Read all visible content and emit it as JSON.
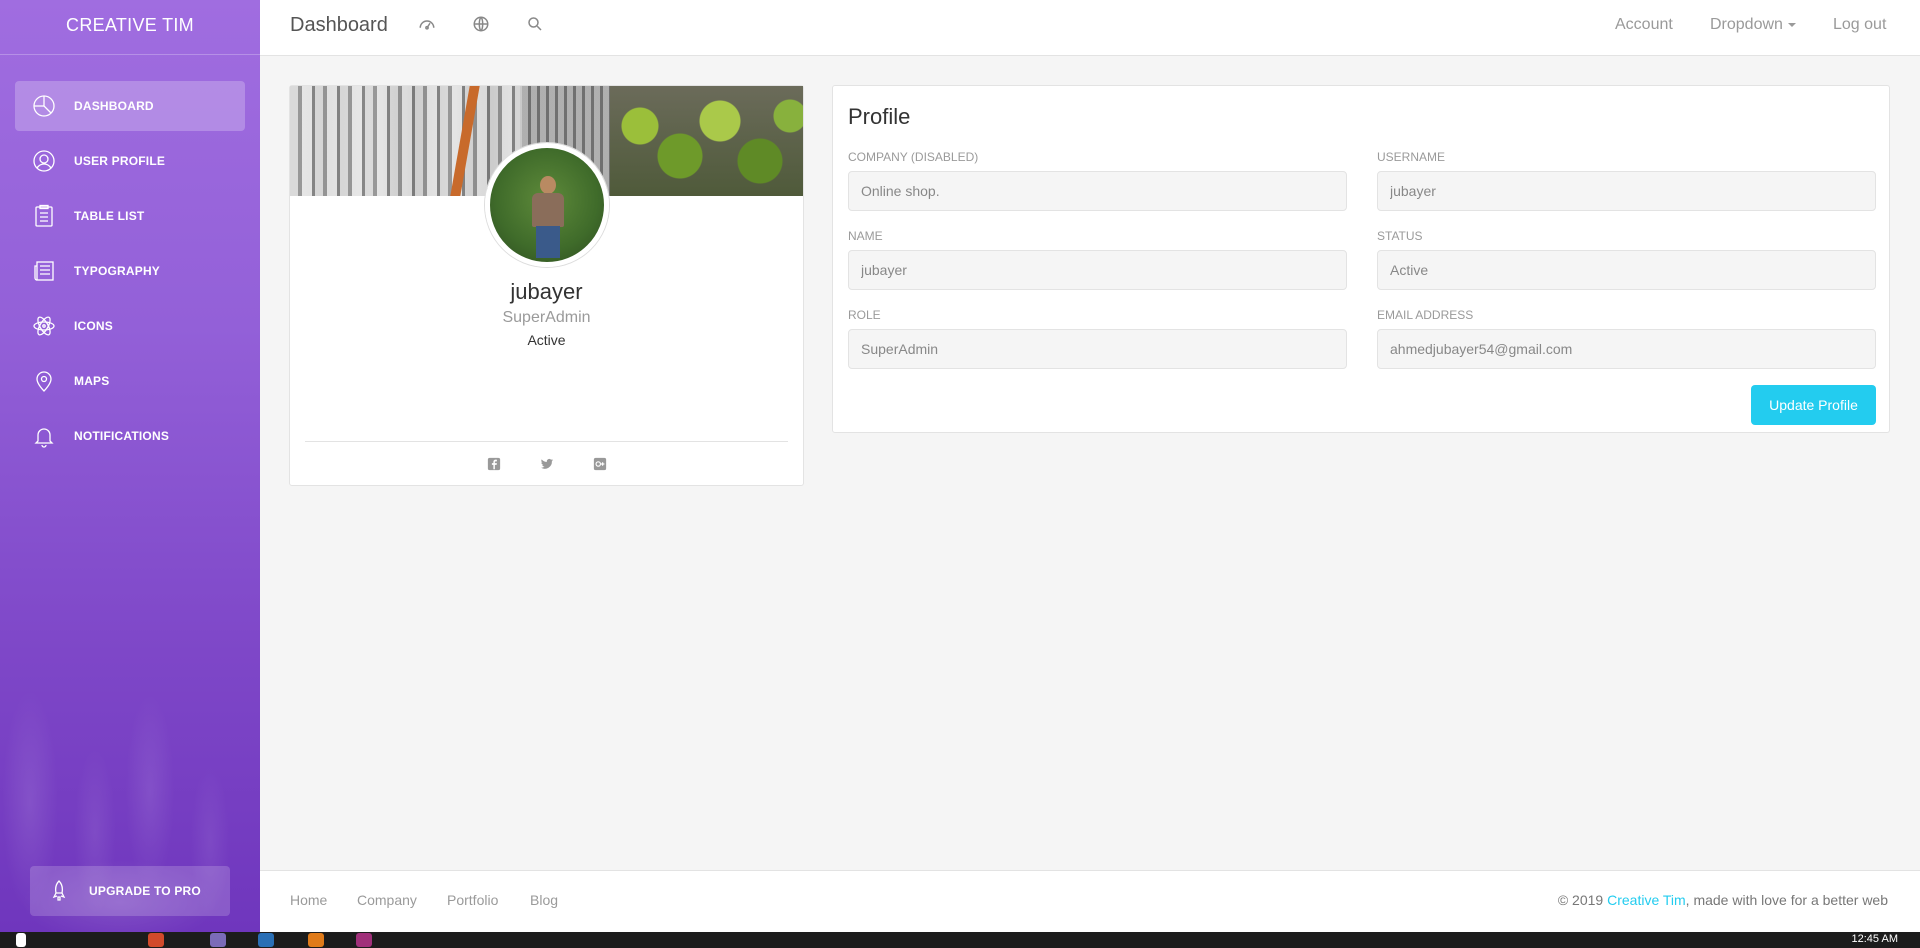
{
  "brand": "CREATIVE TIM",
  "sidebar": {
    "items": [
      {
        "label": "DASHBOARD",
        "icon": "pie-chart-icon",
        "active": true
      },
      {
        "label": "USER PROFILE",
        "icon": "user-icon"
      },
      {
        "label": "TABLE LIST",
        "icon": "clipboard-icon"
      },
      {
        "label": "TYPOGRAPHY",
        "icon": "news-icon"
      },
      {
        "label": "ICONS",
        "icon": "atom-icon"
      },
      {
        "label": "MAPS",
        "icon": "map-pin-icon"
      },
      {
        "label": "NOTIFICATIONS",
        "icon": "bell-icon"
      }
    ],
    "upgrade": {
      "label": "UPGRADE TO PRO",
      "icon": "rocket-icon"
    }
  },
  "topbar": {
    "title": "Dashboard",
    "icons": [
      "dashboard-icon",
      "globe-icon",
      "search-icon"
    ],
    "account": "Account",
    "dropdown": "Dropdown",
    "logout": "Log out"
  },
  "user_card": {
    "name": "jubayer",
    "role": "SuperAdmin",
    "status": "Active",
    "social": [
      "facebook-icon",
      "twitter-icon",
      "google-plus-icon"
    ]
  },
  "profile": {
    "title": "Profile",
    "fields": {
      "company": {
        "label": "COMPANY (DISABLED)",
        "value": "Online shop."
      },
      "username": {
        "label": "USERNAME",
        "value": "jubayer"
      },
      "name": {
        "label": "NAME",
        "value": "jubayer"
      },
      "status": {
        "label": "STATUS",
        "value": "Active"
      },
      "role": {
        "label": "ROLE",
        "value": "SuperAdmin"
      },
      "email": {
        "label": "EMAIL ADDRESS",
        "value": "ahmedjubayer54@gmail.com"
      }
    },
    "update_label": "Update Profile"
  },
  "footer": {
    "links": [
      "Home",
      "Company",
      "Portfolio",
      "Blog"
    ],
    "copyright_prefix": "© 2019 ",
    "copyright_link": "Creative Tim",
    "copyright_suffix": ", made with love for a better web"
  },
  "taskbar": {
    "clock": "12:45 AM"
  },
  "colors": {
    "accent": "#23ccef",
    "sidebar_top": "#a06de0",
    "sidebar_bottom": "#6f36bd"
  }
}
